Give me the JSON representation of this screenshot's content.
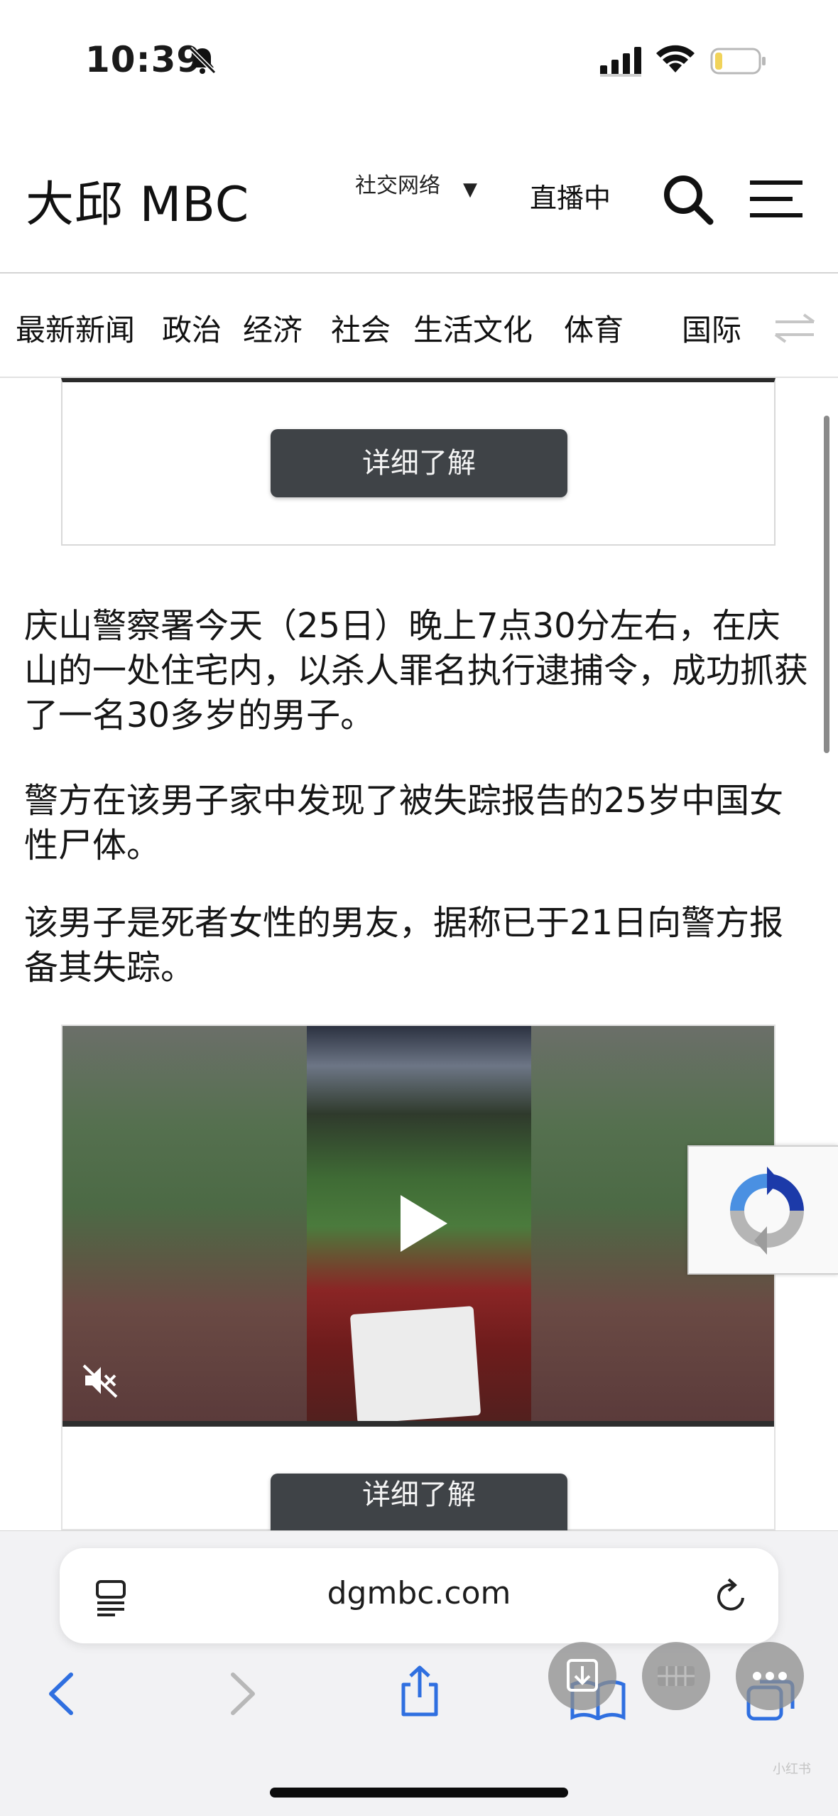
{
  "status_bar": {
    "time": "10:39",
    "icons": [
      "bell-slash-icon",
      "cellular-signal-icon",
      "wifi-icon",
      "battery-icon"
    ]
  },
  "header": {
    "logo": "大邱 MBC",
    "sns_label": "社交网络",
    "sns_caret": "▼",
    "live_label": "直播中",
    "icons": [
      "search-icon",
      "hamburger-menu-icon"
    ]
  },
  "categories": [
    {
      "label": "最新新闻"
    },
    {
      "label": "政治"
    },
    {
      "label": "经济"
    },
    {
      "label": "社会"
    },
    {
      "label": "生活文化"
    },
    {
      "label": "体育"
    },
    {
      "label": "国际"
    }
  ],
  "article": {
    "ad_button_top": "详细了解",
    "paragraphs": [
      "庆山警察署今天（25日）晚上7点30分左右，在庆山的一处住宅内，以杀人罪名执行逮捕令，成功抓获了一名30多岁的男子。",
      "警方在该男子家中发现了被失踪报告的25岁中国女性尸体。",
      "该男子是死者女性的男友，据称已于21日向警方报备其失踪。"
    ],
    "ad_button_bottom": "详细了解"
  },
  "video": {
    "icons": [
      "play-icon",
      "muted-speaker-icon"
    ]
  },
  "browser": {
    "url": "dgmbc.com",
    "icons": [
      "reader-icon",
      "reload-icon",
      "back-icon",
      "forward-icon",
      "share-icon",
      "bookmarks-icon",
      "tabs-icon"
    ],
    "floating_buttons": [
      "download-icon",
      "grid-icon",
      "more-icon"
    ]
  },
  "watermark": "小红书"
}
